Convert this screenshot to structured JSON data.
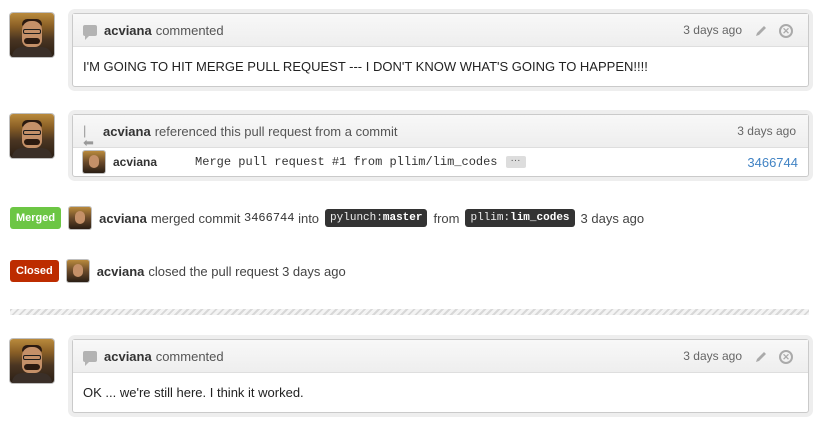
{
  "comments": [
    {
      "author": "acviana",
      "action": "commented",
      "time": "3 days ago",
      "body": "I'M GOING TO HIT MERGE PULL REQUEST --- I DON'T KNOW WHAT'S GOING TO HAPPEN!!!!"
    },
    {
      "author": "acviana",
      "action": "commented",
      "time": "3 days ago",
      "body": "OK ... we're still here. I think it worked."
    }
  ],
  "reference": {
    "author": "acviana",
    "action": "referenced this pull request from a commit",
    "time": "3 days ago",
    "commit": {
      "author": "acviana",
      "message": "Merge pull request #1 from pllim/lim_codes",
      "ellipsis": "···",
      "sha": "3466744"
    }
  },
  "merged_event": {
    "badge": "Merged",
    "author": "acviana",
    "text_merged": "merged commit",
    "sha": "3466744",
    "text_into": "into",
    "base_owner": "pylunch",
    "base_branch": "master",
    "text_from": "from",
    "head_owner": "pllim",
    "head_branch": "lim_codes",
    "time": "3 days ago"
  },
  "closed_event": {
    "badge": "Closed",
    "author": "acviana",
    "text": "closed the pull request 3 days ago"
  },
  "colors": {
    "merged": "#6cc644",
    "closed": "#bd2c00",
    "link": "#4183c4"
  }
}
